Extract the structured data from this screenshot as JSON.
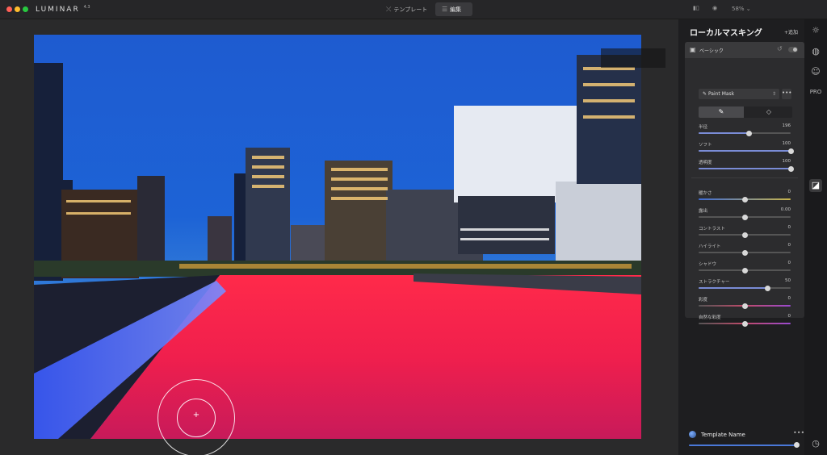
{
  "app": {
    "logo": "LUMINAR",
    "logo_sup": "4.3",
    "tabs": [
      {
        "label": "テンプレート"
      },
      {
        "label": "編集"
      }
    ],
    "zoom": "58%"
  },
  "panel": {
    "title": "ローカルマスキング",
    "add_label": "+追加",
    "layer": {
      "name": "ベーシック"
    },
    "mask_tool": {
      "selected": "Paint Mask",
      "more": "•••"
    },
    "brush_sliders": [
      {
        "label": "半径",
        "value": "196",
        "pos": 0.55
      },
      {
        "label": "ソフト",
        "value": "100",
        "pos": 1.0
      },
      {
        "label": "透明度",
        "value": "100",
        "pos": 1.0
      }
    ],
    "adjust_sliders": [
      {
        "label": "暖かさ",
        "value": "0",
        "pos": 0.5,
        "style": "temp"
      },
      {
        "label": "露出",
        "value": "0.00",
        "pos": 0.5,
        "style": "plain"
      },
      {
        "label": "コントラスト",
        "value": "0",
        "pos": 0.5,
        "style": "plain"
      },
      {
        "label": "ハイライト",
        "value": "0",
        "pos": 0.5,
        "style": "plain"
      },
      {
        "label": "シャドウ",
        "value": "0",
        "pos": 0.5,
        "style": "plain"
      },
      {
        "label": "ストラクチャー",
        "value": "50",
        "pos": 0.75,
        "style": "fill"
      },
      {
        "label": "彩度",
        "value": "0",
        "pos": 0.5,
        "style": "sat"
      },
      {
        "label": "自然な彩度",
        "value": "0",
        "pos": 0.5,
        "style": "sat"
      }
    ]
  },
  "template": {
    "name": "Template Name",
    "more": "•••",
    "amount_pos": 1.0
  },
  "toolbar_icons": [
    "sun-icon",
    "palette-icon",
    "face-icon",
    "pro-icon",
    "local-mask-icon",
    "history-icon"
  ]
}
